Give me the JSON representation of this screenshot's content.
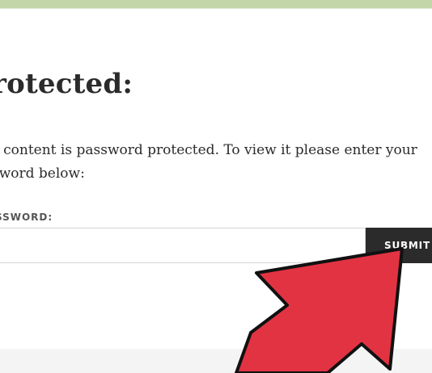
{
  "page": {
    "title": "rotected:",
    "message": "s content is password protected. To view it please enter your sword below:"
  },
  "form": {
    "password_label": "SSWORD:",
    "password_value": "•",
    "submit_label": "SUBMIT"
  },
  "colors": {
    "top_bar": "#c2d6a9",
    "button_bg": "#2b2b2b",
    "arrow_fill": "#e23343",
    "arrow_outline": "#111111"
  },
  "icons": {
    "pointer": "red-arrow-icon"
  }
}
